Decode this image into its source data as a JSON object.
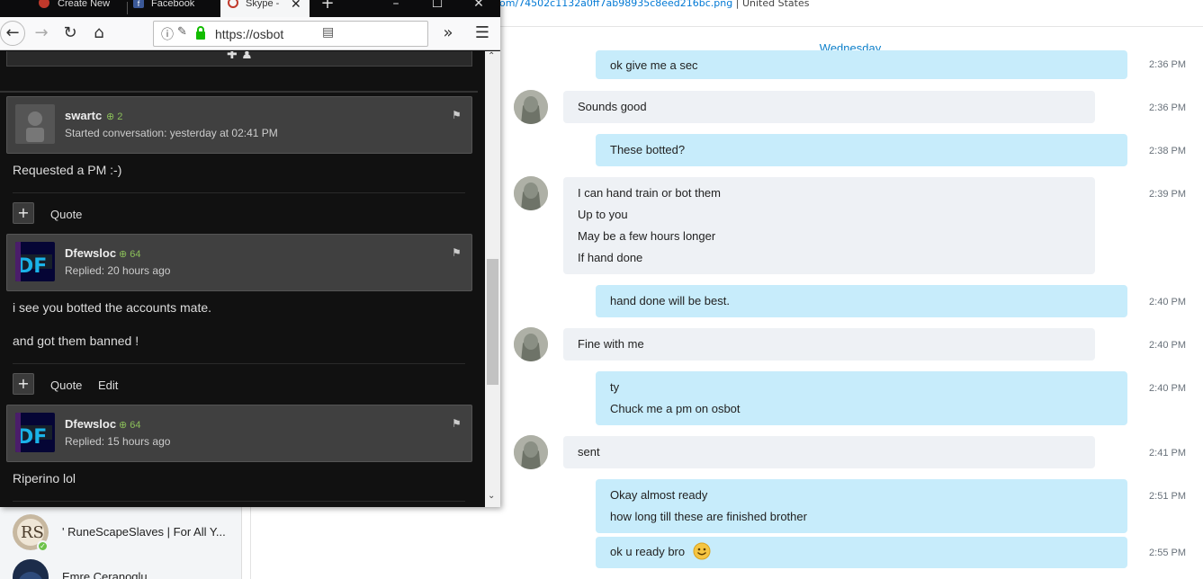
{
  "browser": {
    "tabs": [
      {
        "label": "Create New"
      },
      {
        "label": "Facebook"
      },
      {
        "label": "Skype -",
        "active": true
      }
    ],
    "url": "https://osbot",
    "window_controls": [
      "minimize-icon",
      "maximize-icon",
      "close-icon"
    ]
  },
  "skype_url": {
    "path": "om/74502c1132a0ff7ab98935c8eed216bc.png",
    "separator": "|",
    "region": "United States"
  },
  "forum": {
    "posts": [
      {
        "author": "swartc",
        "rep": "2",
        "meta": "Started conversation: yesterday at 02:41 PM",
        "lines": [
          "Requested a PM :-)"
        ],
        "actions": [
          "Quote"
        ]
      },
      {
        "author": "Dfewsloc",
        "rep": "64",
        "meta": "Replied: 20 hours ago",
        "lines": [
          "i see you botted the accounts mate.",
          "and got them banned !"
        ],
        "actions": [
          "Quote",
          "Edit"
        ]
      },
      {
        "author": "Dfewsloc",
        "rep": "64",
        "meta": "Replied: 15 hours ago",
        "lines": [
          "Riperino lol"
        ]
      }
    ]
  },
  "skype": {
    "day": "Wednesday",
    "contacts": [
      {
        "name": "' RuneScapeSlaves | For All Y..."
      },
      {
        "name": "Emre Ceranoglu"
      }
    ],
    "messages": [
      {
        "dir": "out",
        "lines": [
          "ok give me a sec"
        ],
        "time": "2:36 PM"
      },
      {
        "dir": "in",
        "lines": [
          "Sounds good"
        ],
        "time": "2:36 PM"
      },
      {
        "dir": "out",
        "lines": [
          "These botted?"
        ],
        "time": "2:38 PM"
      },
      {
        "dir": "in",
        "lines": [
          "I can hand train or bot them",
          "Up to you",
          "May be a few hours longer",
          "If hand done"
        ],
        "time": "2:39 PM"
      },
      {
        "dir": "out",
        "lines": [
          "hand done will be best."
        ],
        "time": "2:40 PM"
      },
      {
        "dir": "in",
        "lines": [
          "Fine with me"
        ],
        "time": "2:40 PM"
      },
      {
        "dir": "out",
        "lines": [
          "ty",
          "Chuck me a pm on osbot"
        ],
        "time": "2:40 PM"
      },
      {
        "dir": "in",
        "lines": [
          "sent"
        ],
        "time": "2:41 PM"
      },
      {
        "dir": "out",
        "lines": [
          "Okay almost ready",
          "how long till these are finished brother"
        ],
        "time": "2:51 PM"
      },
      {
        "dir": "out",
        "lines": [
          "ok u ready bro"
        ],
        "time": "2:55 PM",
        "emoji": "smile-emoji"
      }
    ]
  }
}
